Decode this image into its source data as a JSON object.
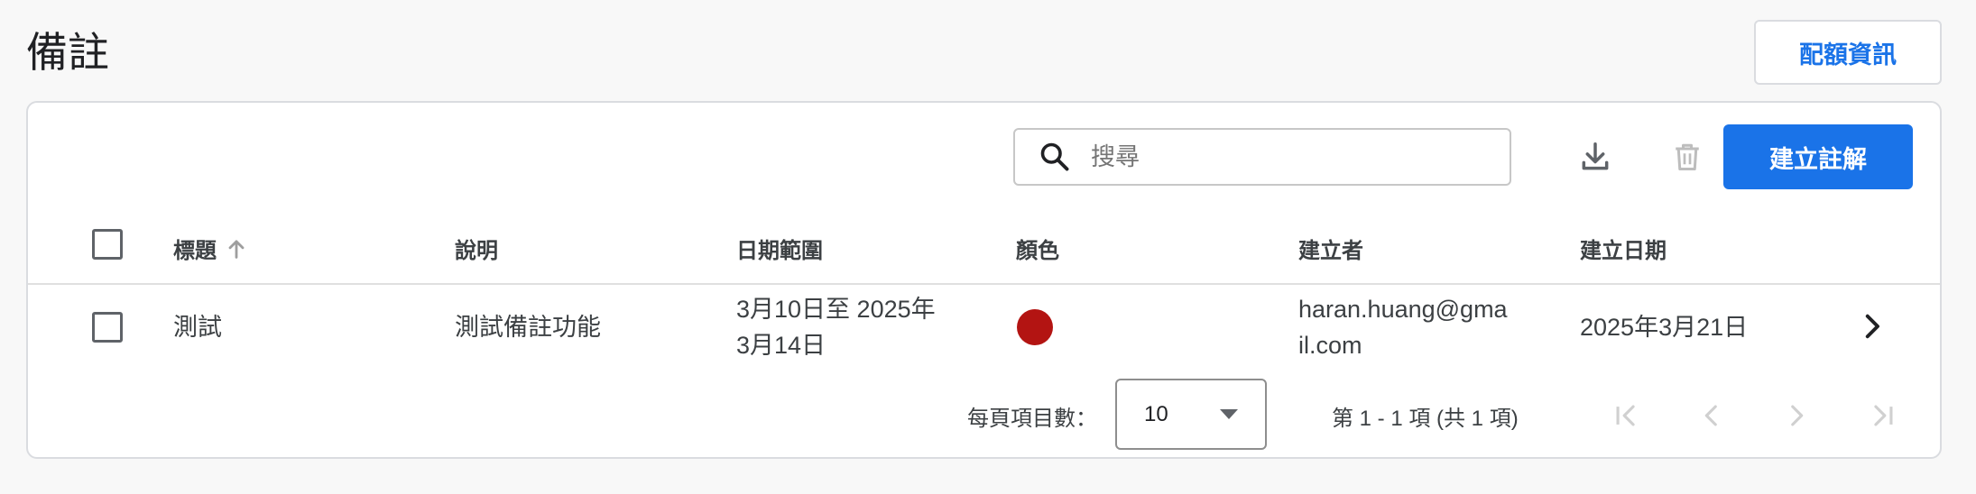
{
  "header": {
    "title": "備註",
    "quota_button": "配額資訊"
  },
  "toolbar": {
    "search_placeholder": "搜尋",
    "search_value": "",
    "download_icon": "download-icon",
    "delete_icon": "trash-icon",
    "create_button": "建立註解"
  },
  "table": {
    "columns": {
      "title": "標題",
      "description": "說明",
      "date_range": "日期範圍",
      "color": "顏色",
      "creator": "建立者",
      "created_date": "建立日期"
    },
    "sort": {
      "column": "title",
      "direction": "ascending"
    },
    "rows": [
      {
        "title": "測試",
        "description": "測試備註功能",
        "date_range_line1": "3月10日至 2025年",
        "date_range_line2": "3月14日",
        "color": "#b31412",
        "creator_line1": "haran.huang@gma",
        "creator_line2": "il.com",
        "created_date": "2025年3月21日"
      }
    ]
  },
  "pagination": {
    "page_size_label": "每頁項目數：",
    "page_size": "10",
    "range_text": "第 1 - 1 項 (共 1 項)"
  },
  "colors": {
    "accent": "#1a73e8",
    "disabled_icon": "#bdbdbd"
  }
}
